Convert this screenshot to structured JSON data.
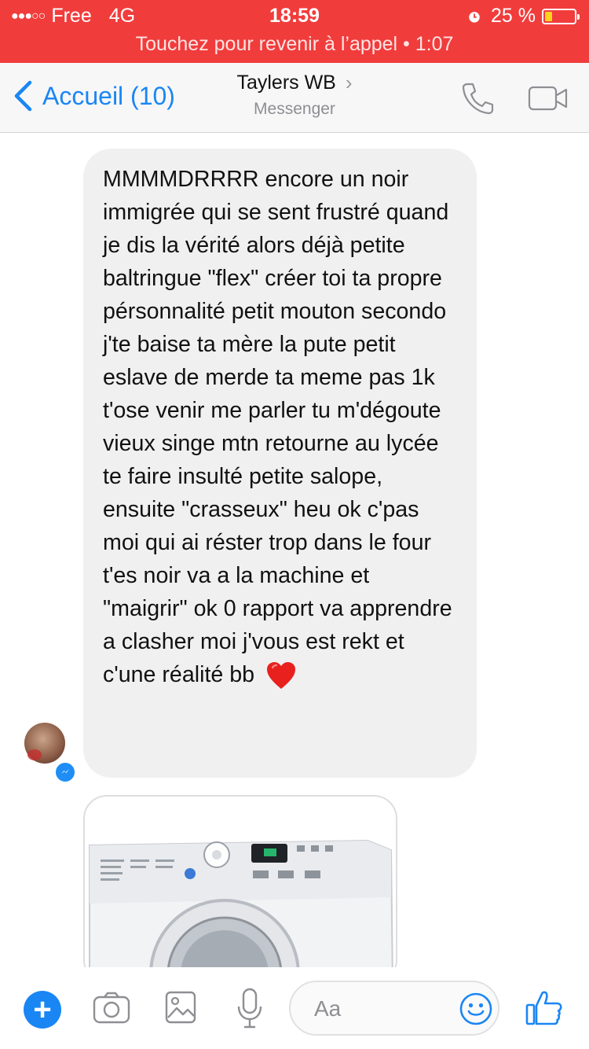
{
  "status_bar": {
    "carrier": "Free",
    "network": "4G",
    "time": "18:59",
    "battery": "25 %",
    "battery_level": 0.25,
    "signal_icon": "signal-dots-icon",
    "alarm_icon": "alarm-icon",
    "call_banner": "Touchez pour revenir à l’appel • 1:07"
  },
  "nav": {
    "back_label": "Accueil (10)",
    "contact_name": "Taylers WB",
    "subtitle": "Messenger",
    "icons": [
      "back-chevron-icon",
      "chevron-right-icon",
      "phone-icon",
      "video-camera-icon"
    ],
    "accent": "#1a86f4"
  },
  "messages": [
    {
      "text": "MMMMDRRRR encore un noir immigrée qui se sent frustré quand je dis la vérité alors déjà petite baltringue \"flex\" créer toi ta propre pérsonnalité petit mouton secondo j'te baise ta mère la pute petit eslave de merde ta meme pas 1k t'ose venir me parler tu m'dégoute vieux singe mtn retourne au lycée te faire insulté petite salope, ensuite \"crasseux\" heu ok c'pas moi qui ai réster trop dans le four t'es noir va a la machine et \"maigrir\" ok 0 rapport va apprendre a clasher moi j'vous est rekt et c'une réalité bb",
      "emoji": "heart-icon"
    },
    {
      "type": "image",
      "image": "washing-machine-photo"
    }
  ],
  "composer": {
    "placeholder": "Aa",
    "icons": [
      "plus-icon",
      "camera-icon",
      "gallery-icon",
      "microphone-icon",
      "emoji-icon",
      "thumbs-up-icon"
    ]
  },
  "colors": {
    "status_bar": "#f13c3c",
    "bubble": "#f1f0f0",
    "accent": "#1a86f4"
  }
}
